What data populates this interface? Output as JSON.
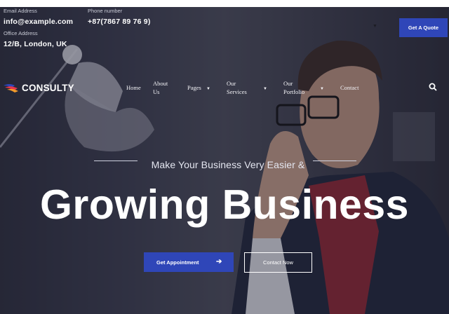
{
  "topbar": {
    "email": {
      "label": "Email Address",
      "value": "info@example.com"
    },
    "phone": {
      "label": "Phone number",
      "value": "+87(7867 89 76 9)"
    },
    "office": {
      "label": "Office Address",
      "value": "12/B, London, UK"
    },
    "quote_button": "Get A Quote",
    "caret_icon": "chevron-down-icon"
  },
  "header": {
    "logo_text": "CONSULTY",
    "nav": [
      {
        "label": "Home"
      },
      {
        "label": "About Us"
      },
      {
        "label": "Pages"
      },
      {
        "label": "Our Services"
      },
      {
        "label": "Our Portfolio"
      },
      {
        "label": "Contact"
      }
    ],
    "search_icon": "search-icon"
  },
  "hero": {
    "subtitle": "Make Your Business Very Easier &",
    "headline": "Growing Business",
    "primary_button": "Get Appointment",
    "primary_icon": "arrow-right-icon",
    "secondary_button": "Contact Now"
  },
  "colors": {
    "accent": "#2f46b8",
    "logo_red": "#e8354a"
  }
}
